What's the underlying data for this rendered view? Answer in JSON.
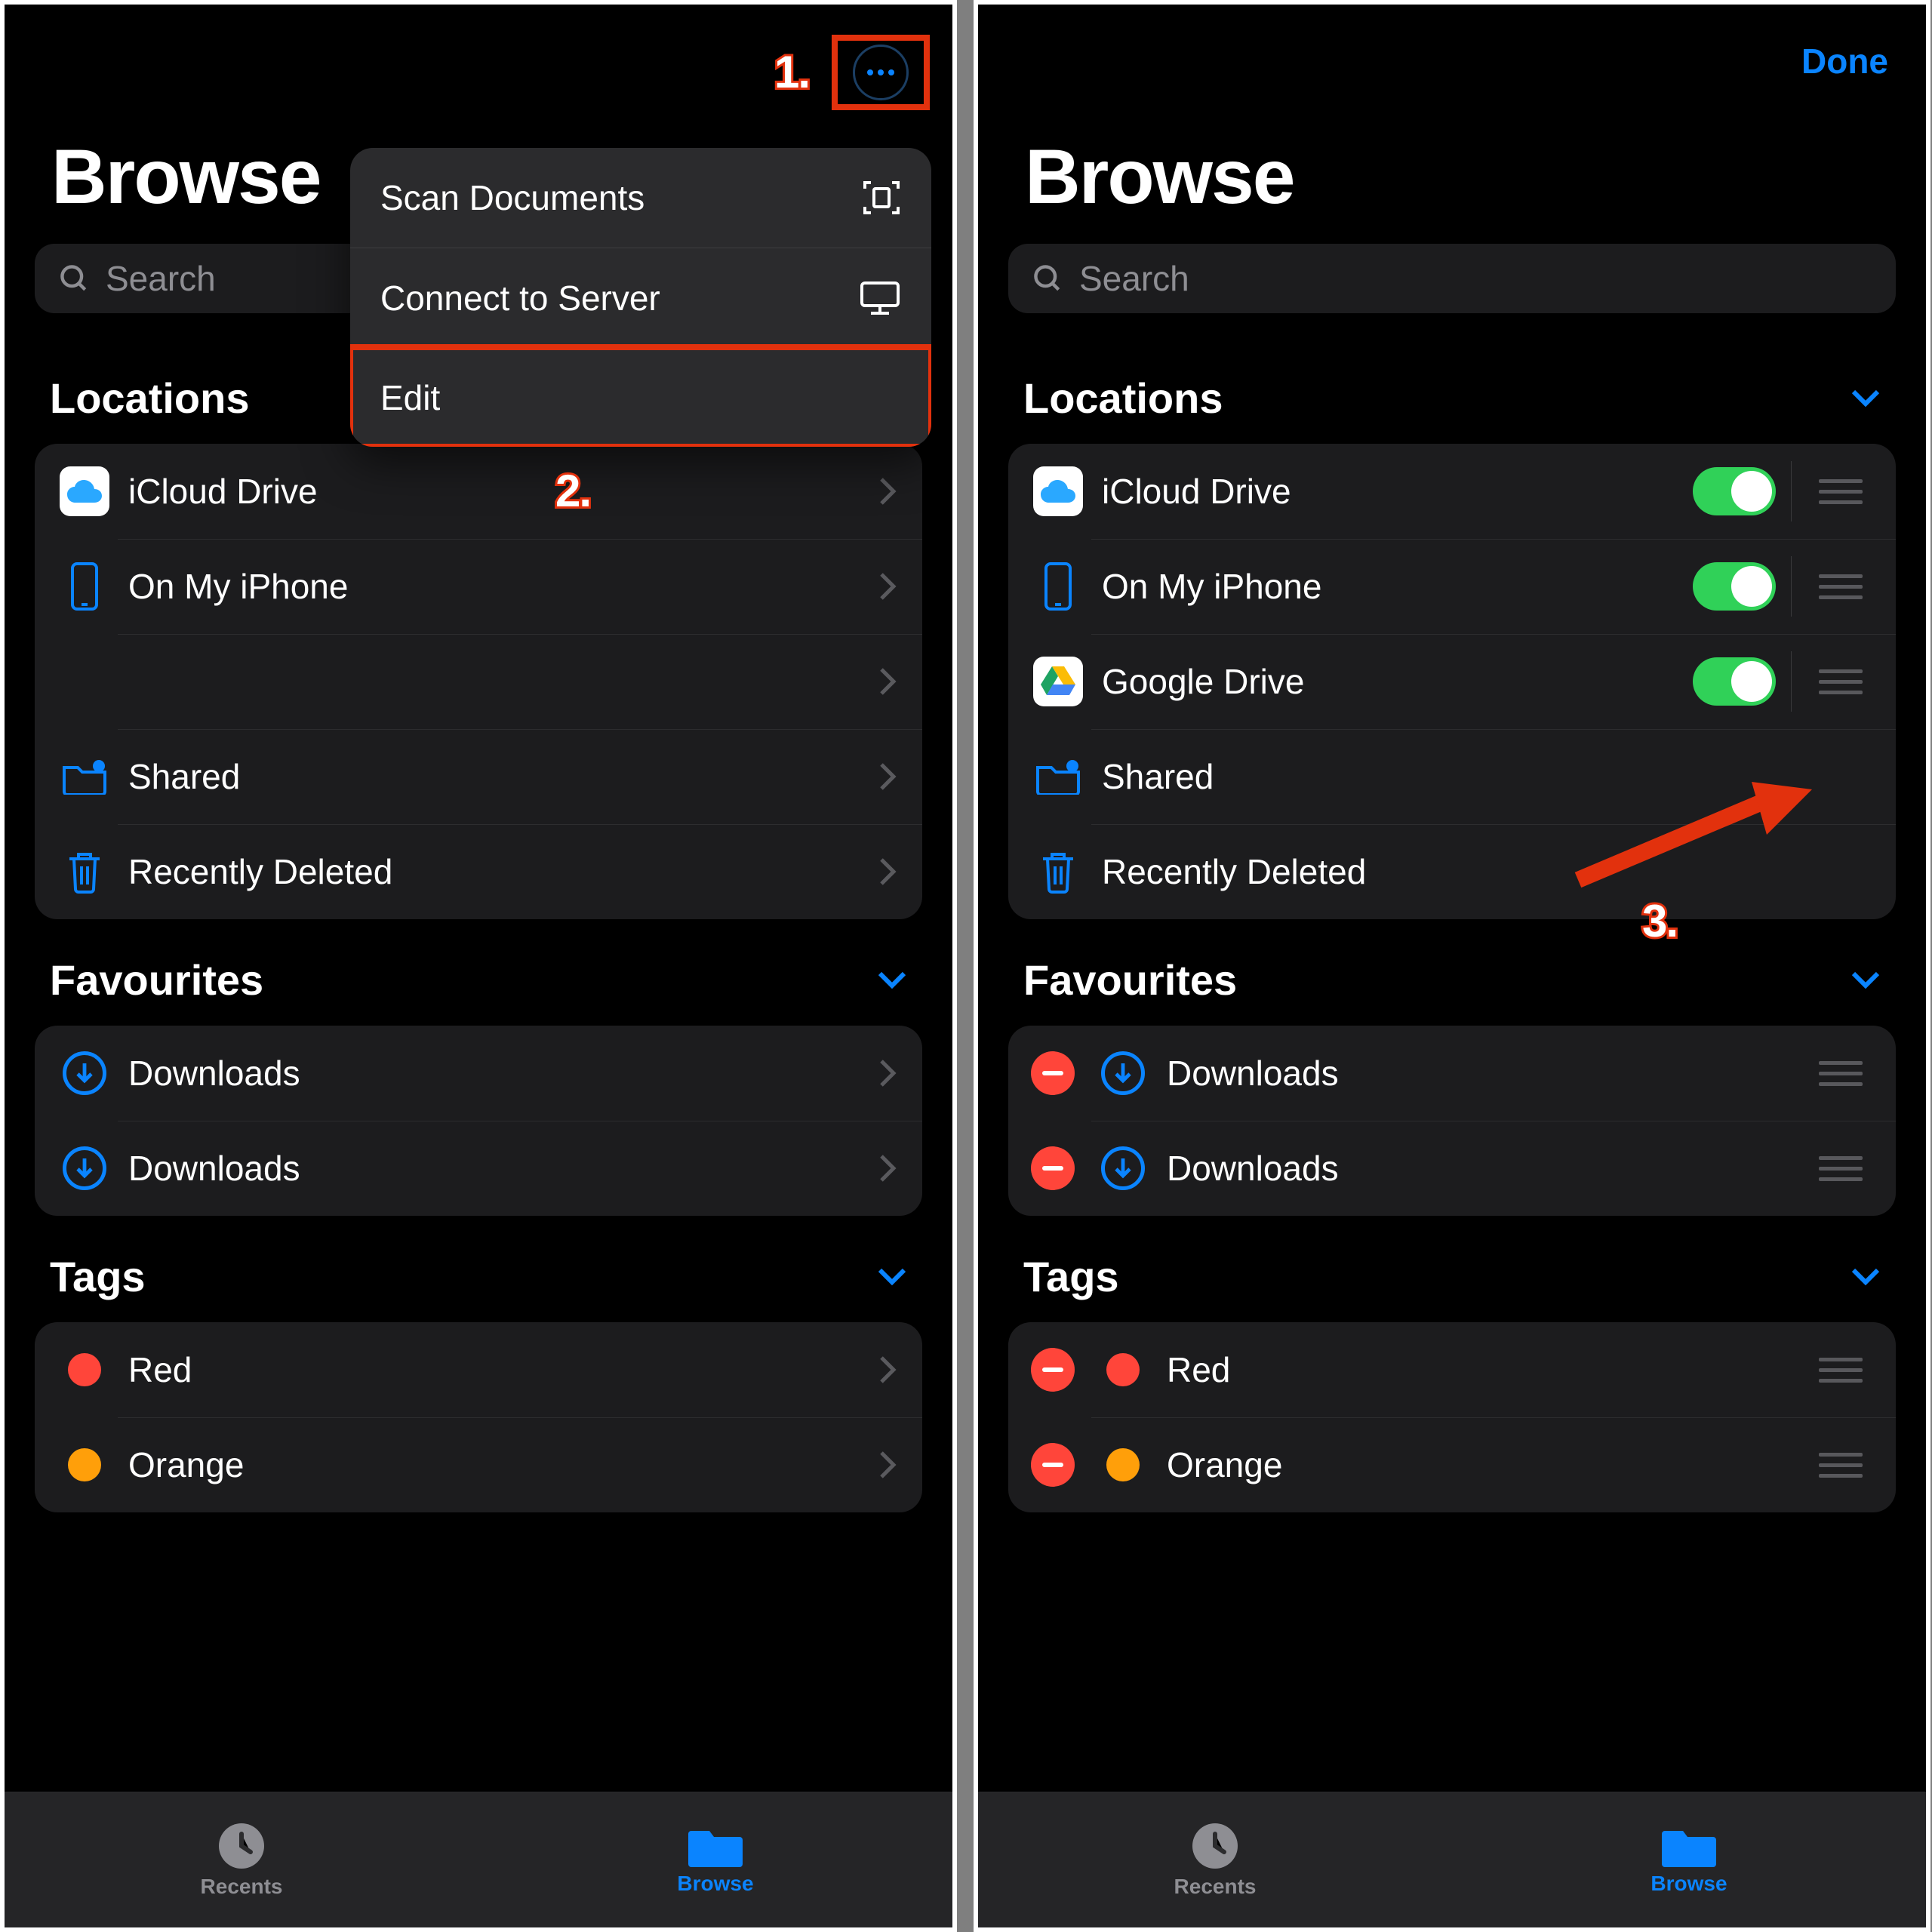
{
  "colors": {
    "accent": "#0a84ff",
    "toggleOn": "#30d158",
    "danger": "#ff453a",
    "annotation": "#e2310d"
  },
  "annotations": {
    "one": "1.",
    "two": "2.",
    "three": "3."
  },
  "left": {
    "title": "Browse",
    "search_placeholder": "Search",
    "menu": {
      "items": [
        {
          "label": "Scan Documents",
          "icon": "document-scan"
        },
        {
          "label": "Connect to Server",
          "icon": "server"
        },
        {
          "label": "Edit",
          "icon": null
        }
      ]
    },
    "sections": {
      "locations": {
        "title": "Locations",
        "rows": [
          {
            "label": "iCloud Drive",
            "icon": "icloud"
          },
          {
            "label": "On My iPhone",
            "icon": "iphone"
          },
          {
            "label": "",
            "icon": "blank"
          },
          {
            "label": "Shared",
            "icon": "shared-folder"
          },
          {
            "label": "Recently Deleted",
            "icon": "trash"
          }
        ]
      },
      "favourites": {
        "title": "Favourites",
        "rows": [
          {
            "label": "Downloads",
            "icon": "download"
          },
          {
            "label": "Downloads",
            "icon": "download"
          }
        ]
      },
      "tags": {
        "title": "Tags",
        "rows": [
          {
            "label": "Red",
            "color": "#ff453a"
          },
          {
            "label": "Orange",
            "color": "#ff9f0a"
          }
        ]
      }
    },
    "tabs": {
      "recents": "Recents",
      "browse": "Browse"
    }
  },
  "right": {
    "done": "Done",
    "title": "Browse",
    "search_placeholder": "Search",
    "sections": {
      "locations": {
        "title": "Locations",
        "rows": [
          {
            "label": "iCloud Drive",
            "icon": "icloud",
            "on": true
          },
          {
            "label": "On My iPhone",
            "icon": "iphone",
            "on": true
          },
          {
            "label": "Google Drive",
            "icon": "gdrive",
            "on": true
          },
          {
            "label": "Shared",
            "icon": "shared-folder"
          },
          {
            "label": "Recently Deleted",
            "icon": "trash"
          }
        ]
      },
      "favourites": {
        "title": "Favourites",
        "rows": [
          {
            "label": "Downloads",
            "icon": "download"
          },
          {
            "label": "Downloads",
            "icon": "download"
          }
        ]
      },
      "tags": {
        "title": "Tags",
        "rows": [
          {
            "label": "Red",
            "color": "#ff453a"
          },
          {
            "label": "Orange",
            "color": "#ff9f0a"
          }
        ]
      }
    },
    "tabs": {
      "recents": "Recents",
      "browse": "Browse"
    }
  }
}
